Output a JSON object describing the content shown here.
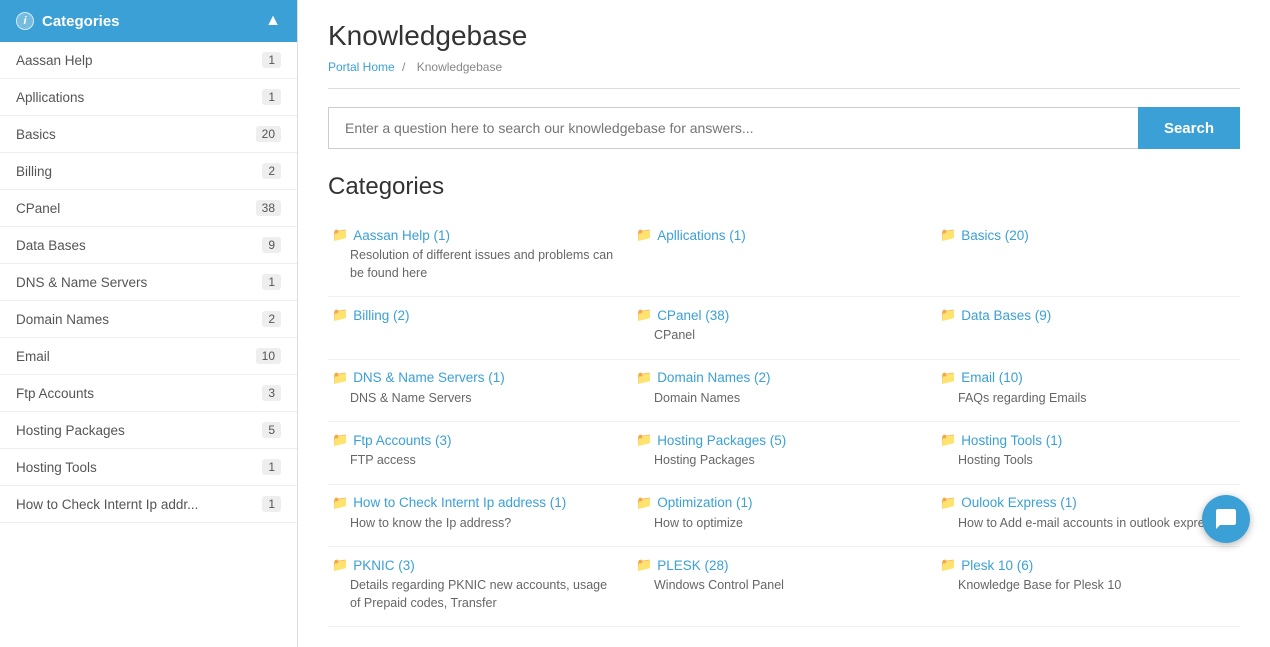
{
  "sidebar": {
    "header": "Categories",
    "items": [
      {
        "label": "Aassan Help",
        "count": 1
      },
      {
        "label": "Apllications",
        "count": 1
      },
      {
        "label": "Basics",
        "count": 20
      },
      {
        "label": "Billing",
        "count": 2
      },
      {
        "label": "CPanel",
        "count": 38
      },
      {
        "label": "Data Bases",
        "count": 9
      },
      {
        "label": "DNS & Name Servers",
        "count": 1
      },
      {
        "label": "Domain Names",
        "count": 2
      },
      {
        "label": "Email",
        "count": 10
      },
      {
        "label": "Ftp Accounts",
        "count": 3
      },
      {
        "label": "Hosting Packages",
        "count": 5
      },
      {
        "label": "Hosting Tools",
        "count": 1
      },
      {
        "label": "How to Check Internt Ip addr...",
        "count": 1
      }
    ]
  },
  "page": {
    "title": "Knowledgebase",
    "breadcrumb_home": "Portal Home",
    "breadcrumb_current": "Knowledgebase",
    "search_placeholder": "Enter a question here to search our knowledgebase for answers...",
    "search_button": "Search",
    "categories_title": "Categories"
  },
  "categories": [
    {
      "name": "Aassan Help (1)",
      "desc": "Resolution of different issues and problems can be found here"
    },
    {
      "name": "Apllications (1)",
      "desc": ""
    },
    {
      "name": "Basics (20)",
      "desc": ""
    },
    {
      "name": "Billing (2)",
      "desc": ""
    },
    {
      "name": "CPanel (38)",
      "desc": "CPanel"
    },
    {
      "name": "Data Bases (9)",
      "desc": ""
    },
    {
      "name": "DNS & Name Servers (1)",
      "desc": "DNS & Name Servers"
    },
    {
      "name": "Domain Names (2)",
      "desc": "Domain Names"
    },
    {
      "name": "Email (10)",
      "desc": "FAQs regarding Emails"
    },
    {
      "name": "Ftp Accounts (3)",
      "desc": "FTP access"
    },
    {
      "name": "Hosting Packages (5)",
      "desc": "Hosting Packages"
    },
    {
      "name": "Hosting Tools (1)",
      "desc": "Hosting Tools"
    },
    {
      "name": "How to Check Internt Ip address (1)",
      "desc": "How to know the Ip address?"
    },
    {
      "name": "Optimization (1)",
      "desc": "How to optimize"
    },
    {
      "name": "Oulook Express (1)",
      "desc": "How to Add e-mail accounts in outlook express"
    },
    {
      "name": "PKNIC (3)",
      "desc": "Details regarding PKNIC new accounts, usage of Prepaid codes, Transfer"
    },
    {
      "name": "PLESK (28)",
      "desc": "Windows Control Panel"
    },
    {
      "name": "Plesk 10 (6)",
      "desc": "Knowledge Base for Plesk 10"
    }
  ]
}
